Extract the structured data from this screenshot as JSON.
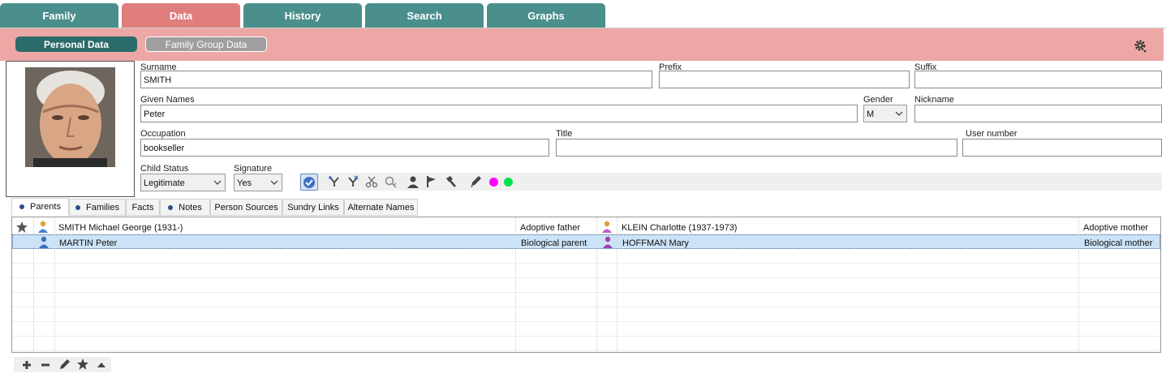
{
  "top_tabs": [
    "Family",
    "Data",
    "History",
    "Search",
    "Graphs"
  ],
  "sub_tabs": {
    "personal": "Personal Data",
    "family_group": "Family Group Data"
  },
  "form": {
    "surname_label": "Surname",
    "surname": "SMITH",
    "prefix_label": "Prefix",
    "prefix": "",
    "suffix_label": "Suffix",
    "suffix": "",
    "given_label": "Given Names",
    "given": "Peter",
    "gender_label": "Gender",
    "gender": "M",
    "nickname_label": "Nickname",
    "nickname": "",
    "occupation_label": "Occupation",
    "occupation": "bookseller",
    "title_label": "Title",
    "title": "",
    "usernum_label": "User number",
    "usernum": "",
    "child_status_label": "Child Status",
    "child_status": "Legitimate",
    "signature_label": "Signature",
    "signature": "Yes"
  },
  "colors": {
    "magenta_dot": "#ff00ff",
    "green_dot": "#00e050",
    "teal": "#4a8f8c",
    "pink": "#eda8a6"
  },
  "lower_tabs": [
    "Parents",
    "Families",
    "Facts",
    "Notes",
    "Person Sources",
    "Sundry Links",
    "Alternate Names"
  ],
  "parents": [
    {
      "father": "SMITH Michael George (1931-)",
      "father_relation": "Adoptive father",
      "mother": "KLEIN Charlotte (1937-1973)",
      "mother_relation": "Adoptive mother"
    },
    {
      "father": "MARTIN Peter",
      "father_relation": "Biological parent",
      "mother": "HOFFMAN Mary",
      "mother_relation": "Biological mother"
    }
  ]
}
